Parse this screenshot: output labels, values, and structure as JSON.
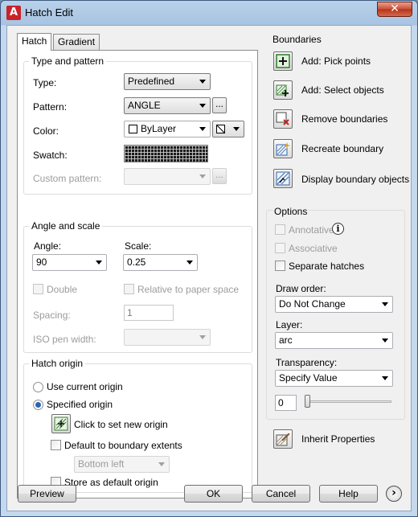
{
  "window": {
    "title": "Hatch Edit",
    "close_glyph": "✕",
    "app_icon_glyph": "A"
  },
  "tabs": [
    {
      "label": "Hatch",
      "active": true
    },
    {
      "label": "Gradient",
      "active": false
    }
  ],
  "type_and_pattern": {
    "legend": "Type and pattern",
    "type_label": "Type:",
    "type_value": "Predefined",
    "pattern_label": "Pattern:",
    "pattern_value": "ANGLE",
    "color_label": "Color:",
    "color_value": "ByLayer",
    "swatch_label": "Swatch:",
    "custom_pattern_label": "Custom pattern:",
    "custom_pattern_value": "",
    "browse_label": "..."
  },
  "angle_and_scale": {
    "legend": "Angle and scale",
    "angle_label": "Angle:",
    "angle_value": "90",
    "scale_label": "Scale:",
    "scale_value": "0.25",
    "double_label": "Double",
    "double_checked": false,
    "relative_label": "Relative to paper space",
    "relative_checked": false,
    "spacing_label": "Spacing:",
    "spacing_value": "1",
    "iso_label": "ISO pen width:",
    "iso_value": ""
  },
  "hatch_origin": {
    "legend": "Hatch origin",
    "use_current_label": "Use current origin",
    "specified_label": "Specified origin",
    "selected": "specified",
    "click_set_label": "Click to set new origin",
    "default_extents_label": "Default to boundary extents",
    "default_extents_checked": false,
    "extents_value": "Bottom left",
    "store_default_label": "Store as default origin",
    "store_default_checked": false
  },
  "boundaries": {
    "legend": "Boundaries",
    "add_pick_label": "Add: Pick points",
    "add_select_label": "Add: Select objects",
    "remove_label": "Remove boundaries",
    "recreate_label": "Recreate boundary",
    "display_label": "Display boundary objects"
  },
  "options": {
    "legend": "Options",
    "annotative_label": "Annotative",
    "annotative_checked": false,
    "associative_label": "Associative",
    "associative_checked": false,
    "separate_label": "Separate hatches",
    "separate_checked": false,
    "draw_order_label": "Draw order:",
    "draw_order_value": "Do Not Change",
    "layer_label": "Layer:",
    "layer_value": "arc",
    "transparency_label": "Transparency:",
    "transparency_value": "Specify Value",
    "transparency_amount": "0",
    "transparency_level": 0
  },
  "inherit_label": "Inherit Properties",
  "footer": {
    "preview_label": "Preview",
    "ok_label": "OK",
    "cancel_label": "Cancel",
    "help_label": "Help",
    "more_glyph": "›"
  },
  "colors": {
    "title_bar": "#b9d1ea",
    "face": "#f0f0f0",
    "close": "#c74f35",
    "accent": "#2a63b8"
  }
}
